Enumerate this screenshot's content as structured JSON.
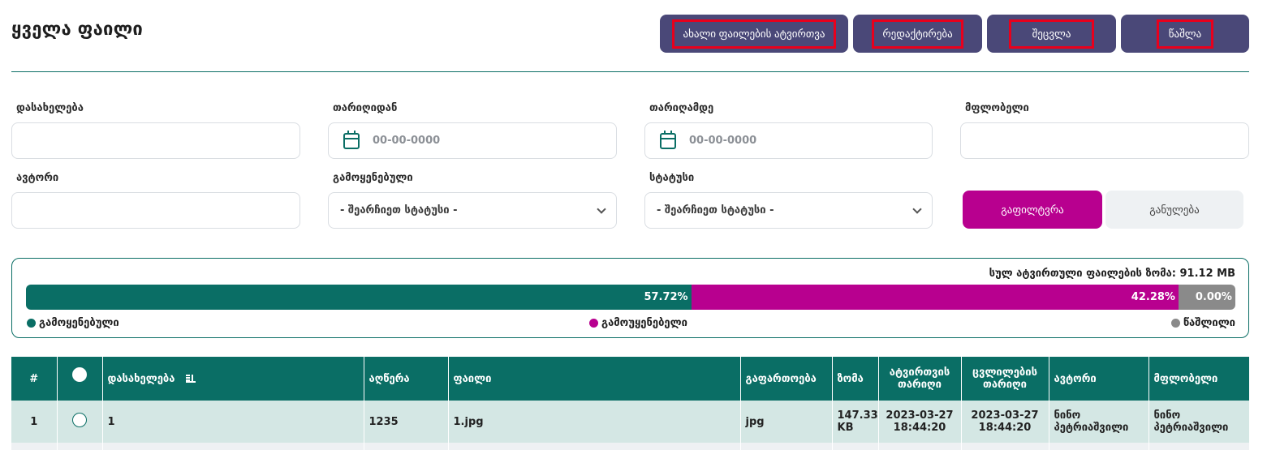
{
  "page": {
    "title": "ყველა ფაილი"
  },
  "actions": {
    "upload_label": "ახალი ფაილების ატვირთვა",
    "edit_label": "რედაქტირება",
    "change_label": "შეცვლა",
    "delete_label": "წაშლა"
  },
  "filters": {
    "name_label": "დასახელება",
    "date_from_label": "თარიღიდან",
    "date_from_placeholder": "00-00-0000",
    "date_to_label": "თარიღამდე",
    "date_to_placeholder": "00-00-0000",
    "owner_label": "მფლობელი",
    "author_label": "ავტორი",
    "used_label": "გამოყენებული",
    "used_select_value": "- შეარჩიეთ სტატუსი -",
    "status_label": "სტატუსი",
    "status_select_value": "- შეარჩიეთ სტატუსი -",
    "filter_button": "გაფილტვრა",
    "reset_button": "განულება"
  },
  "storage": {
    "total_text": "სულ ატვირთული ფაილების ზომა: 91.12 MB",
    "segments": [
      {
        "label": "57.72%",
        "percent": 57.72,
        "color": "#0a6e65"
      },
      {
        "label": "42.28%",
        "percent": 42.28,
        "color": "#b8008f"
      },
      {
        "label": "0.00%",
        "percent": 0.0,
        "color": "#8a8a8a"
      }
    ],
    "legend": {
      "used": "გამოყენებული",
      "unused": "გამოუყენებელი",
      "deleted": "წაშლილი"
    }
  },
  "table": {
    "headers": {
      "index": "#",
      "name": "დასახელება",
      "description": "აღწერა",
      "file": "ფაილი",
      "extension": "გაფართოება",
      "size": "ზომა",
      "upload_date": "ატვირთვის თარიღი",
      "modified_date": "ცვლილების თარიღი",
      "author": "ავტორი",
      "owner": "მფლობელი"
    },
    "rows": [
      {
        "index": "1",
        "name": "1",
        "description": "1235",
        "file": "1.jpg",
        "extension": "jpg",
        "size": "147.33 KB",
        "upload_date": "2023-03-27 18:44:20",
        "modified_date": "2023-03-27 18:44:20",
        "author": "ნინო პეტრიაშვილი",
        "owner": "ნინო პეტრიაშვილი"
      }
    ]
  }
}
